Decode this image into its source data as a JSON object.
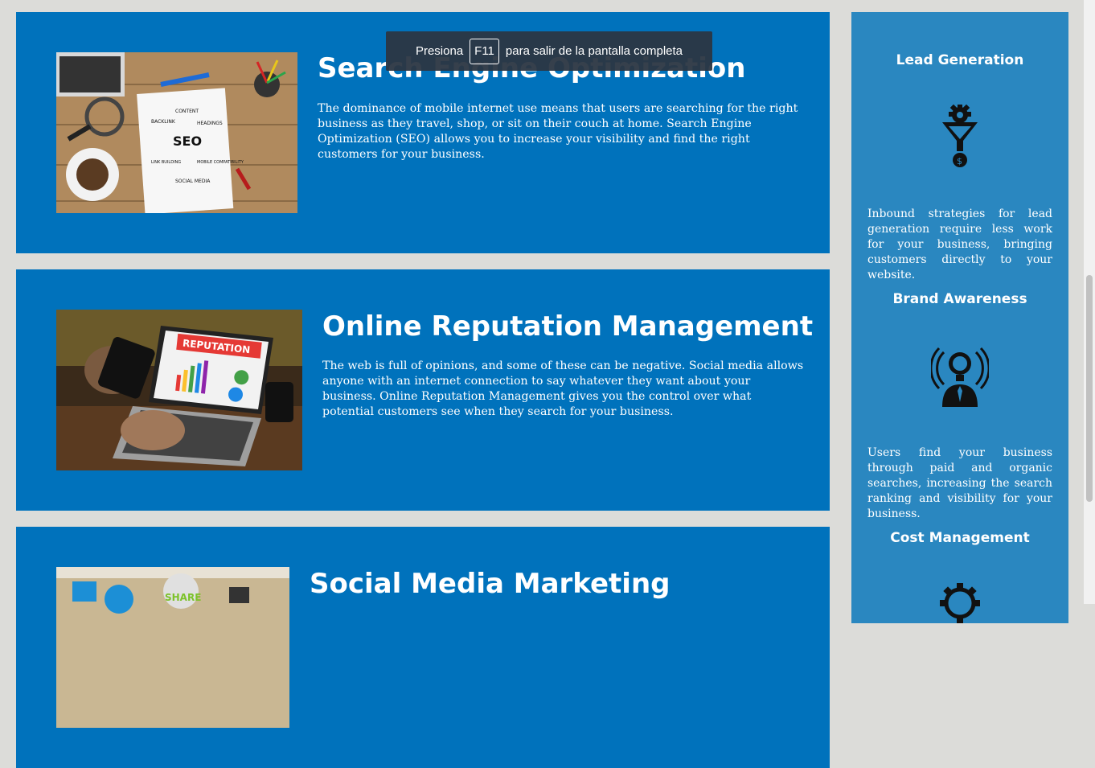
{
  "cards": [
    {
      "title": "Search Engine Optimization",
      "text": "The dominance of mobile internet use means that users are searching for the right business as they travel, shop, or sit on their couch at home. Search Engine Optimization (SEO) allows you to increase your visibility and find the right customers for your business.",
      "image_words": [
        "CONTENT",
        "BACKLINK",
        "HEADINGS",
        "SEO",
        "LINK BUILDING",
        "MOBILE COMPATIBILITY",
        "SOCIAL MEDIA"
      ]
    },
    {
      "title": "Online Reputation Management",
      "text": "The web is full of opinions, and some of these can be negative. Social media allows anyone with an internet connection to say whatever they want about your business. Online Reputation Management gives you the control over what potential customers see when they search for your business.",
      "image_words": [
        "REPUTATION"
      ]
    },
    {
      "title": "Social Media Marketing",
      "text": "",
      "image_words": [
        "SHARE"
      ]
    }
  ],
  "sidebar": [
    {
      "title": "Lead Generation",
      "text": "Inbound strategies for lead generation require less work for your business, bringing customers directly to your website.",
      "icon": "funnel-gear-icon"
    },
    {
      "title": "Brand Awareness",
      "text": "Users find your business through paid and organic searches, increasing the search ranking and visibility for your business.",
      "icon": "lightbulb-person-icon"
    },
    {
      "title": "Cost Management",
      "text": "",
      "icon": "gear-icon"
    }
  ],
  "toast": {
    "before": "Presiona",
    "key": "F11",
    "after": "para salir de la pantalla completa"
  },
  "colors": {
    "card": "#0072bc",
    "sidebar": "#2a87c0",
    "page": "#dcdcd9"
  }
}
